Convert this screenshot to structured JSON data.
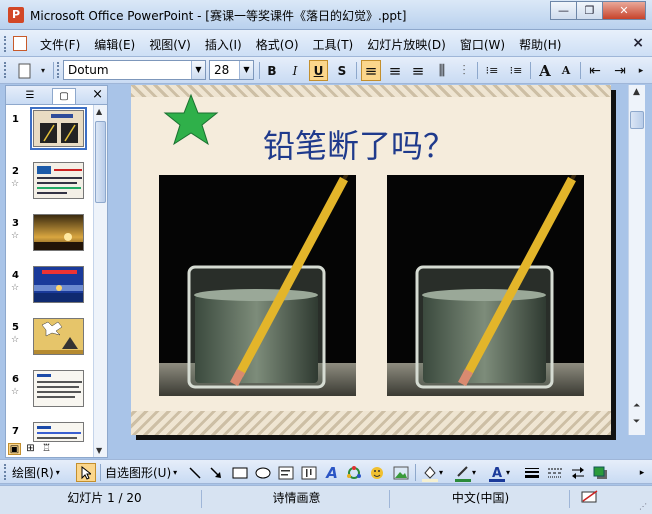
{
  "window": {
    "title": "Microsoft Office PowerPoint - [赛课一等奖课件《落日的幻觉》.ppt]",
    "minimize": "—",
    "restore": "❐",
    "close": "✕"
  },
  "menu": {
    "items": [
      "文件(F)",
      "编辑(E)",
      "视图(V)",
      "插入(I)",
      "格式(O)",
      "工具(T)",
      "幻灯片放映(D)",
      "窗口(W)",
      "帮助(H)"
    ],
    "close": "×"
  },
  "toolbar": {
    "font_name": "Dotum",
    "font_size": "28",
    "bold": "B",
    "italic": "I",
    "underline": "U",
    "shadow": "S",
    "align_left": "≡",
    "center": "≡",
    "align_right": "≡",
    "distribute": "⫼",
    "numbering": "⁝≡",
    "bullets": "⁝≡",
    "increase_font": "A",
    "decrease_font": "A",
    "decrease_indent": "⇤",
    "increase_indent": "⇥"
  },
  "panel": {
    "tab_outline": "☰",
    "tab_slides": "▢",
    "close": "×",
    "thumbnails": [
      {
        "num": "1",
        "selected": true
      },
      {
        "num": "2",
        "selected": false
      },
      {
        "num": "3",
        "selected": false
      },
      {
        "num": "4",
        "selected": false
      },
      {
        "num": "5",
        "selected": false
      },
      {
        "num": "6",
        "selected": false
      },
      {
        "num": "7",
        "selected": false
      }
    ],
    "star": "☆"
  },
  "slide": {
    "title": "铅笔断了吗？"
  },
  "drawing": {
    "draw_menu": "绘图(R)",
    "autoshapes": "自选图形(U)"
  },
  "status": {
    "slide_counter": "幻灯片 1 / 20",
    "design": "诗情画意",
    "language": "中文(中国)"
  },
  "colors": {
    "title_color": "#1f3a8c",
    "star_fill": "#2fb04a",
    "slide_bg": "#f5ecdc"
  }
}
